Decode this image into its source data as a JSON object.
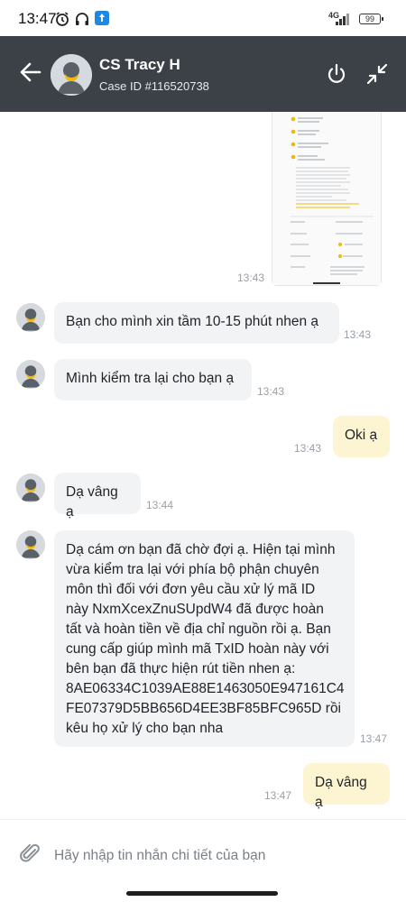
{
  "status_bar": {
    "time": "13:47",
    "network": "4G",
    "battery": "99"
  },
  "header": {
    "agent_name": "CS Tracy H",
    "case_id": "Case ID #116520738"
  },
  "screenshot_attachment": {
    "time": "13:43"
  },
  "messages": [
    {
      "side": "agent",
      "text": "Bạn cho mình xin tầm 10-15 phút nhen ạ",
      "time": "13:43"
    },
    {
      "side": "agent",
      "text": "Mình kiểm tra lại cho bạn ạ",
      "time": "13:43"
    },
    {
      "side": "user",
      "text": "Oki ạ",
      "time": "13:43"
    },
    {
      "side": "agent",
      "text": "Dạ vâng ạ",
      "time": "13:44"
    },
    {
      "side": "agent",
      "lines": [
        "Dạ cám ơn bạn đã chờ đợi ạ. Hiện tại mình",
        "vừa kiểm tra lại với phía bộ phận chuyên",
        "môn thì đối với đơn yêu cầu xử lý mã ID",
        "này NxmXcexZnuSUpdW4 đã được hoàn",
        "tất và hoàn tiền về địa chỉ nguồn rồi ạ. Bạn",
        "cung cấp giúp mình mã TxID hoàn này với",
        "bên bạn đã thực hiện rút tiền nhen ạ:",
        "8AE06334C1039AE88E1463050E947161C4",
        "FE07379D5BB656D4EE3BF85BFC965D rồi",
        "kêu họ xử lý cho bạn nha"
      ],
      "time": "13:47"
    },
    {
      "side": "user",
      "text": "Dạ vâng ạ",
      "time": "13:47"
    }
  ],
  "input": {
    "placeholder": "Hãy nhập tin nhắn chi tiết của bạn"
  },
  "colors": {
    "header_bg": "#3c4148",
    "agent_bubble": "#f2f3f4",
    "user_bubble": "#fdf4d2",
    "accent": "#f0b90b"
  }
}
